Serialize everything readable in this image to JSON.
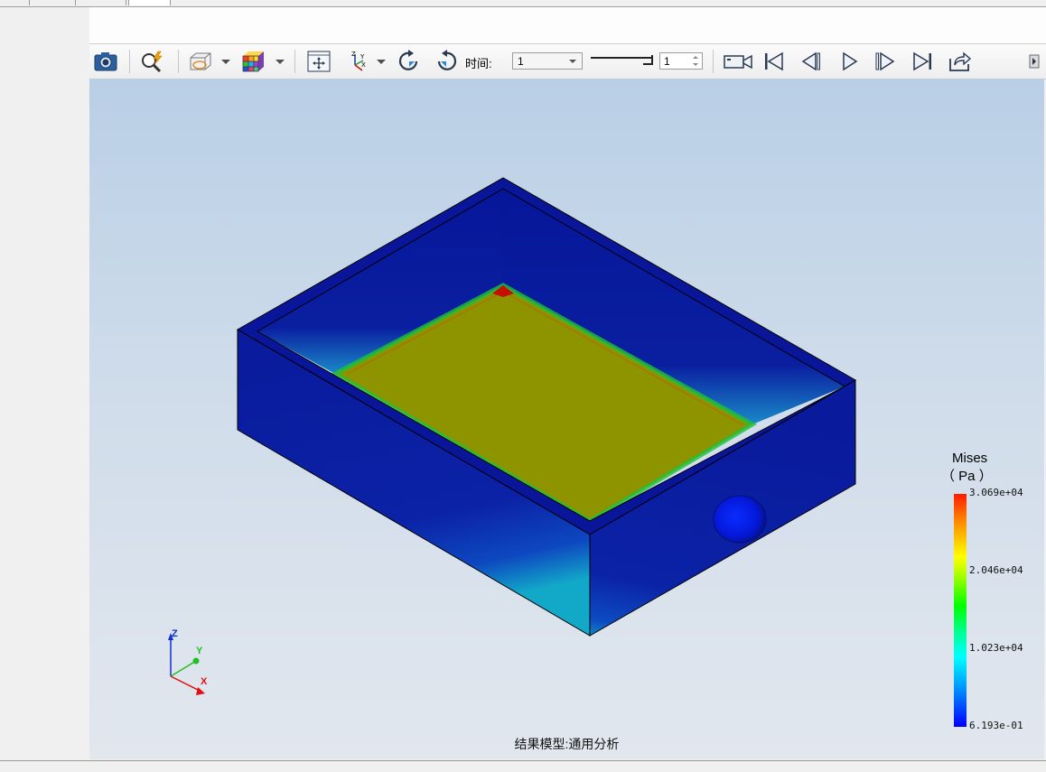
{
  "toolbar": {
    "time_label": "时间:",
    "time_select_value": "1",
    "frame_value": "1"
  },
  "legend": {
    "title": "Mises",
    "unit": "（ Pa ）",
    "ticks": [
      "3.069e+04",
      "2.046e+04",
      "1.023e+04",
      "6.193e-01"
    ]
  },
  "viewport": {
    "result_model_label": "结果模型:通用分析"
  },
  "axis_triad": {
    "z": "Z",
    "y": "Y",
    "x": "X"
  },
  "colors": {
    "axis_z": "#1030d0",
    "axis_y": "#20c020",
    "axis_x": "#e01010",
    "model_blue": "#0a1a9a",
    "floor_yellow": "#8e9400"
  },
  "icons": [
    "camera-icon",
    "zoom-lightning-icon",
    "section-view-icon",
    "color-cube-icon",
    "fit-view-icon",
    "coordinate-axes-icon",
    "rotate-ccw-icon",
    "rotate-cw-icon",
    "record-video-icon",
    "first-frame-icon",
    "prev-frame-icon",
    "play-icon",
    "next-frame-icon",
    "last-frame-icon",
    "export-icon",
    "panel-toggle-icon"
  ]
}
